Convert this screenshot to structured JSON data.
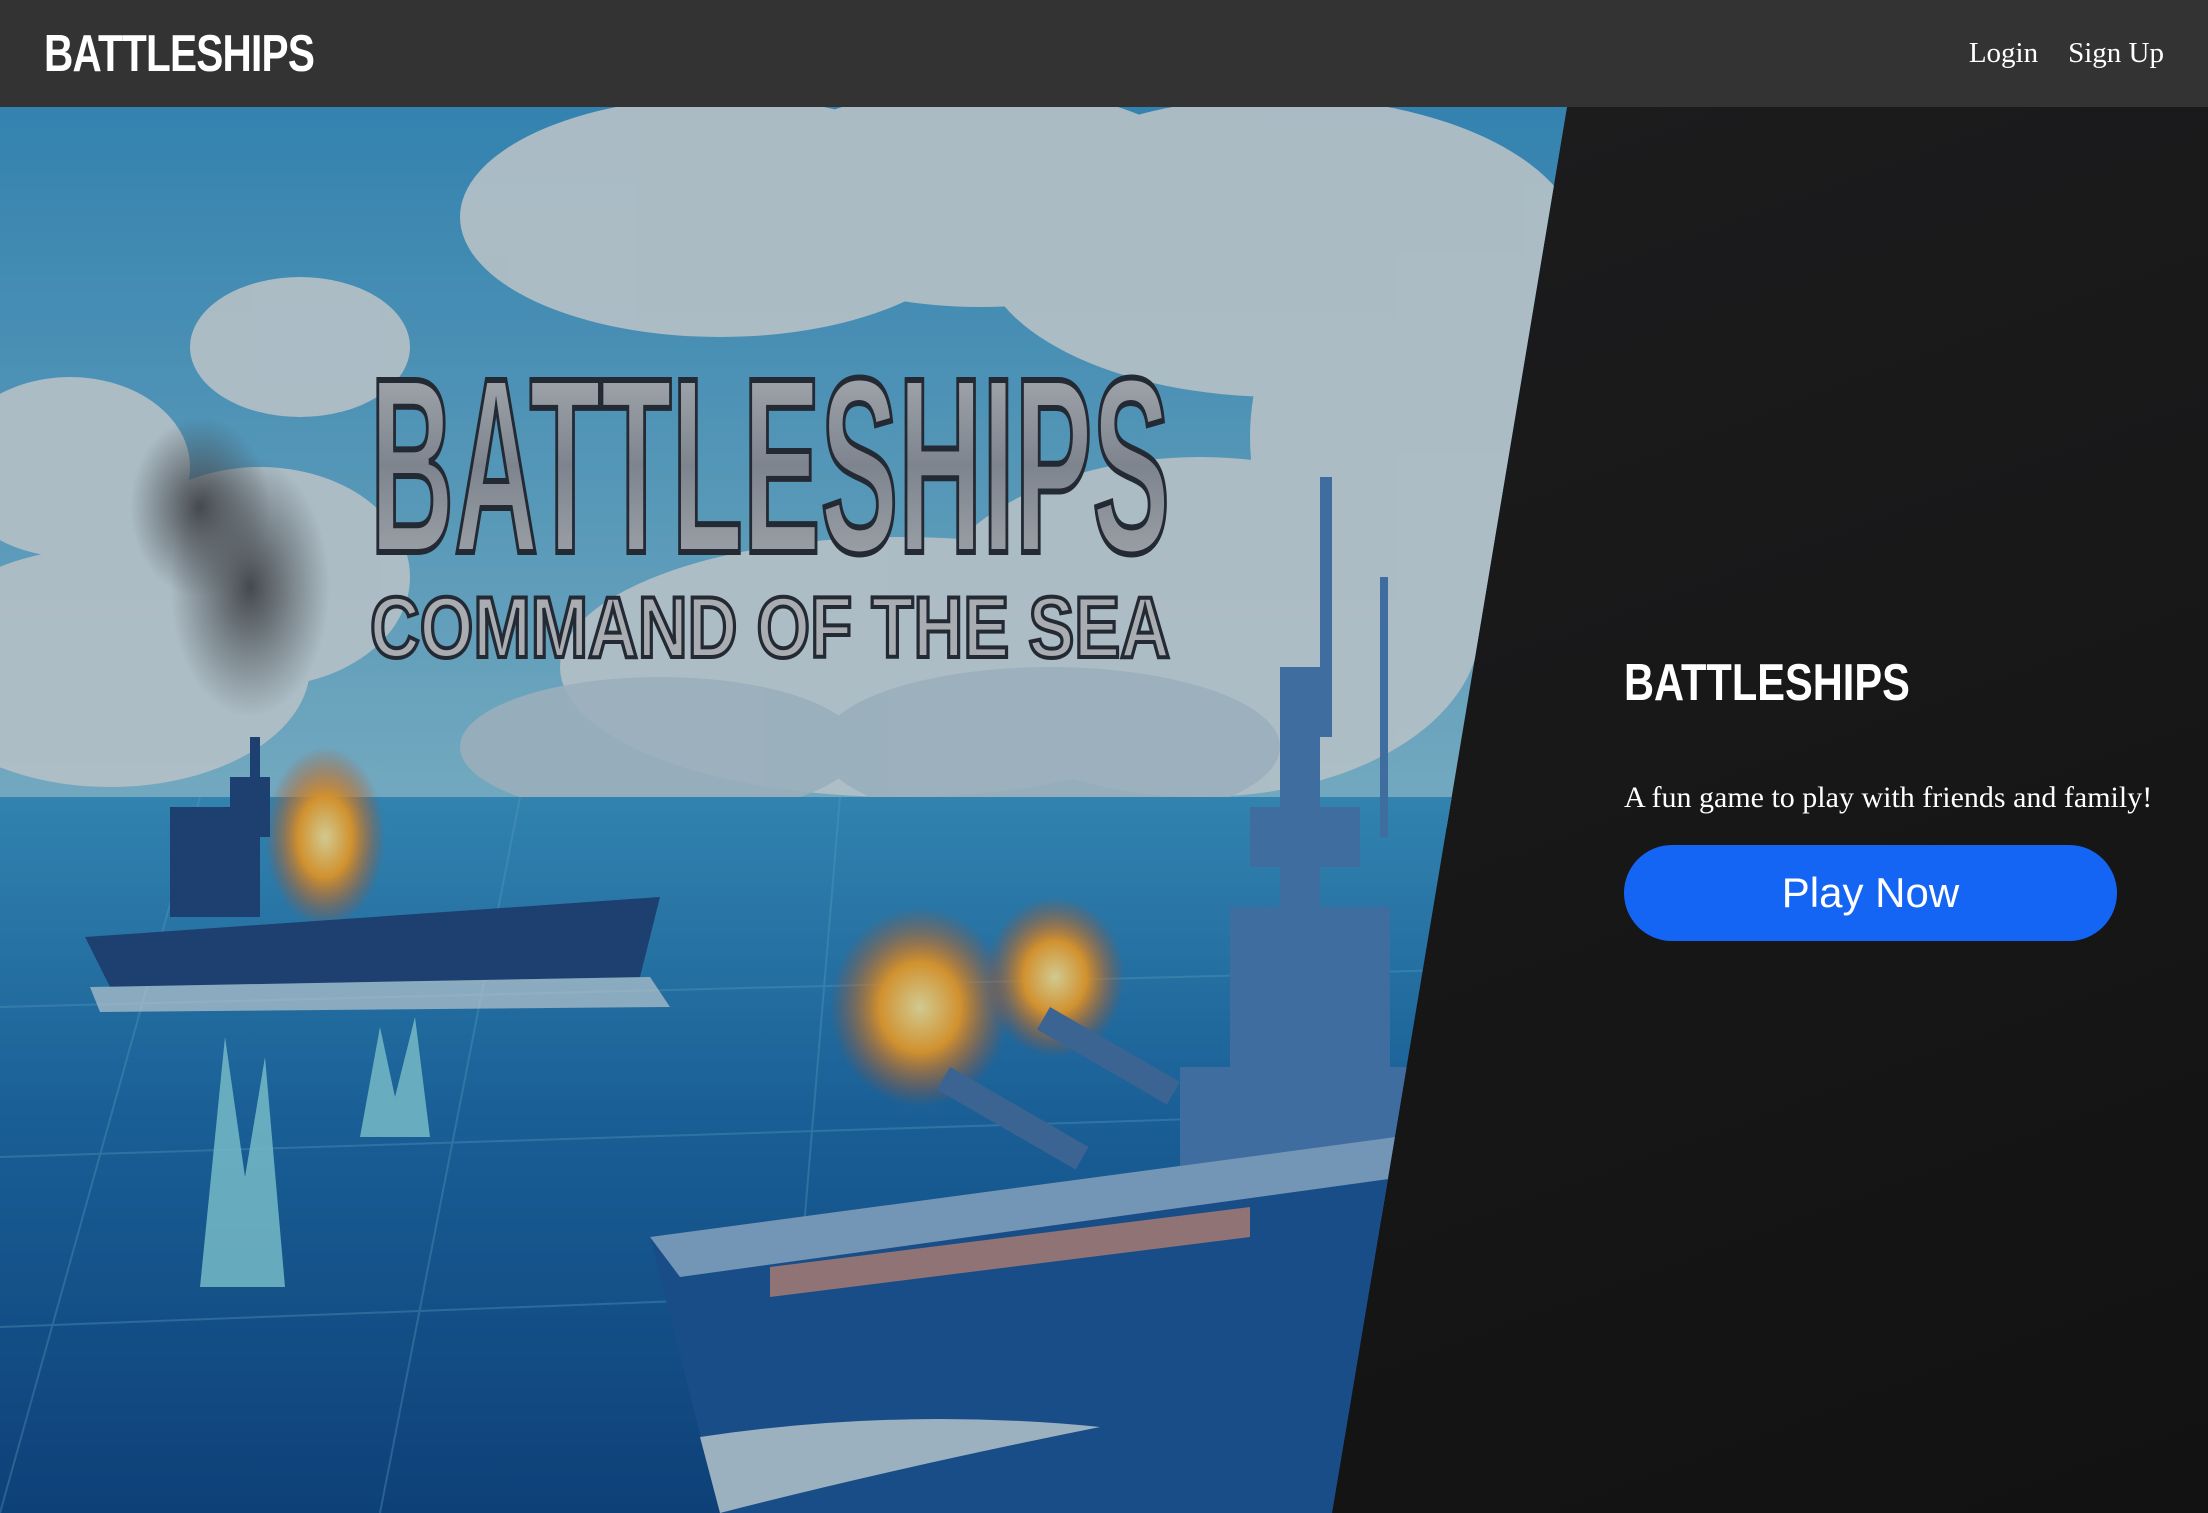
{
  "navbar": {
    "brand": "BATTLESHIPS",
    "links": [
      {
        "label": "Login"
      },
      {
        "label": "Sign Up"
      }
    ]
  },
  "hero": {
    "art_title": "BATTLESHIPS",
    "art_subtitle": "COMMAND OF THE SEA"
  },
  "panel": {
    "title": "BATTLESHIPS",
    "subtitle": "A fun game to play with friends and family!",
    "cta_label": "Play Now"
  },
  "colors": {
    "navbar_bg": "#333333",
    "panel_bg": "#141414",
    "cta_bg": "#1565f5",
    "sky": "#5fb2dd",
    "sea": "#1e6fb3"
  }
}
